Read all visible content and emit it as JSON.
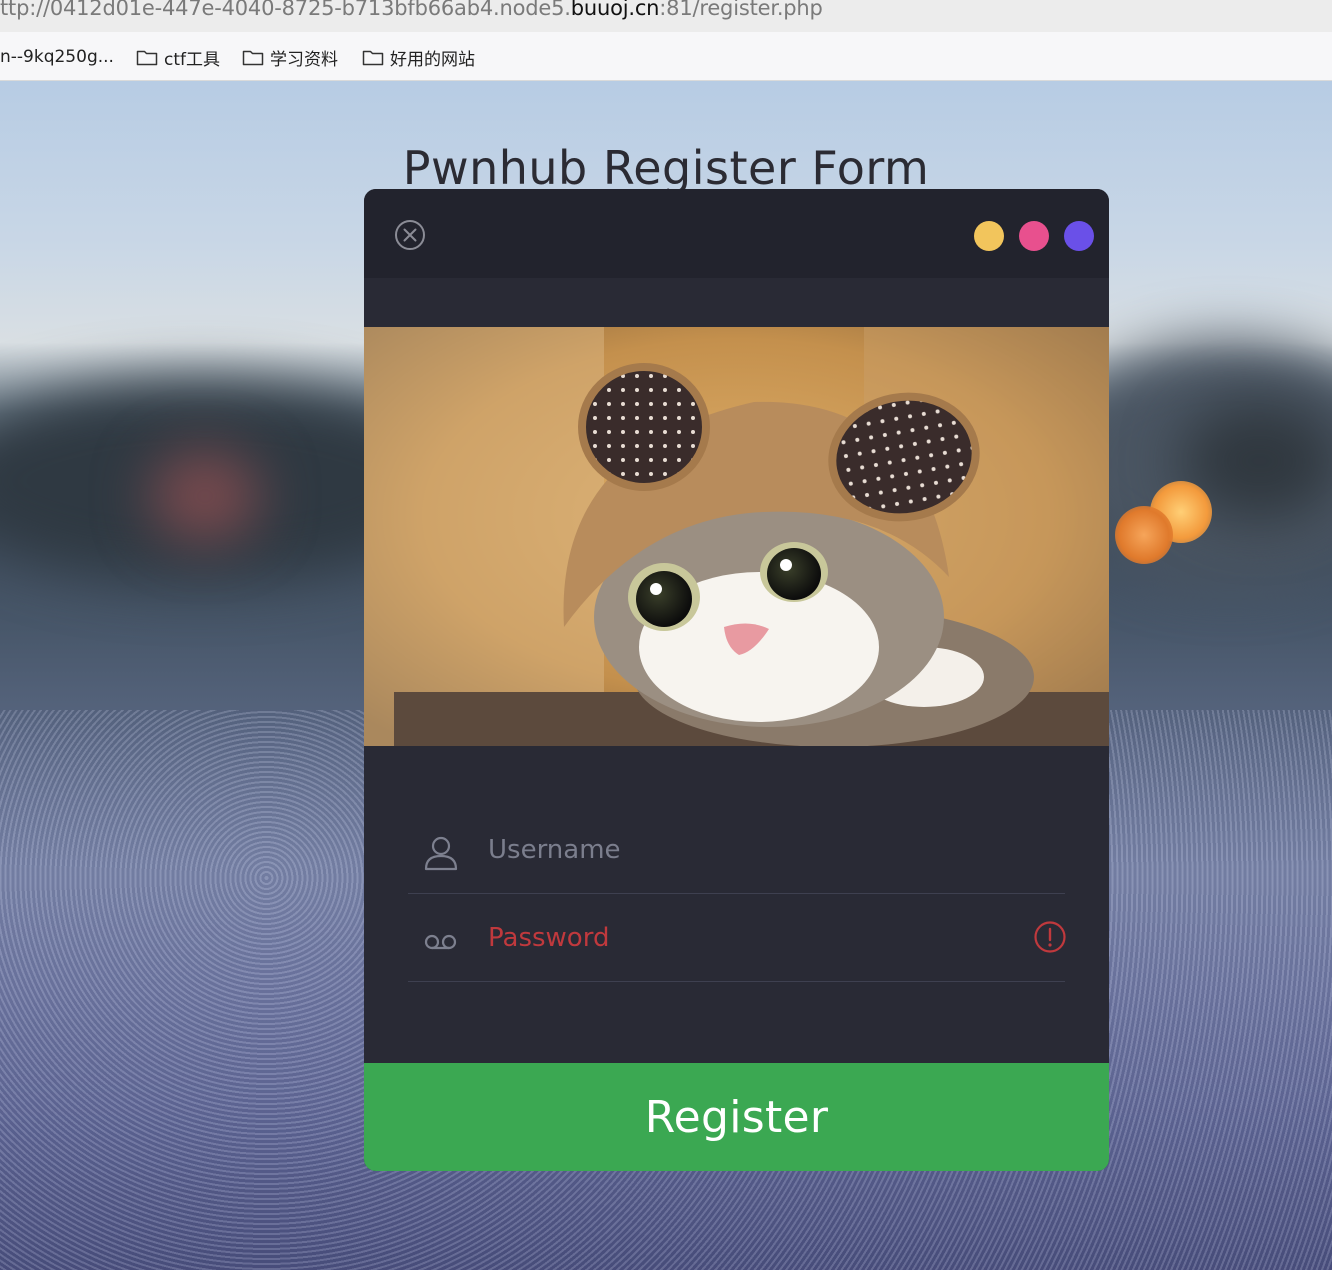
{
  "browser": {
    "url_prefix": "ttp://0412d01e-447e-4040-8725-b713bfb66ab4.node5.",
    "url_host": "buuoj.cn",
    "url_suffix": ":81/register.php",
    "bookmarks": [
      {
        "label": "n--9kq250g...",
        "icon": "none"
      },
      {
        "label": "ctf工具",
        "icon": "folder-icon"
      },
      {
        "label": "学习资料",
        "icon": "folder-icon"
      },
      {
        "label": "好用的网站",
        "icon": "folder-icon"
      }
    ]
  },
  "page": {
    "title": "Pwnhub Register Form"
  },
  "card": {
    "header": {
      "close_icon": "close-circle-icon",
      "dots": [
        {
          "name": "yellow-dot",
          "color": "#f2c55c"
        },
        {
          "name": "pink-dot",
          "color": "#e8508e"
        },
        {
          "name": "purple-dot",
          "color": "#6a50e8"
        }
      ]
    },
    "photo": {
      "icon": "cat-in-bear-hat-photo"
    },
    "username": {
      "placeholder": "Username",
      "value": "",
      "icon": "user-icon"
    },
    "password": {
      "placeholder": "Password",
      "value": "",
      "icon": "voicemail-key-icon",
      "error_icon": "alert-circle-icon",
      "error_color": "#c0393d"
    },
    "register_label": "Register",
    "register_color": "#3ba852"
  }
}
